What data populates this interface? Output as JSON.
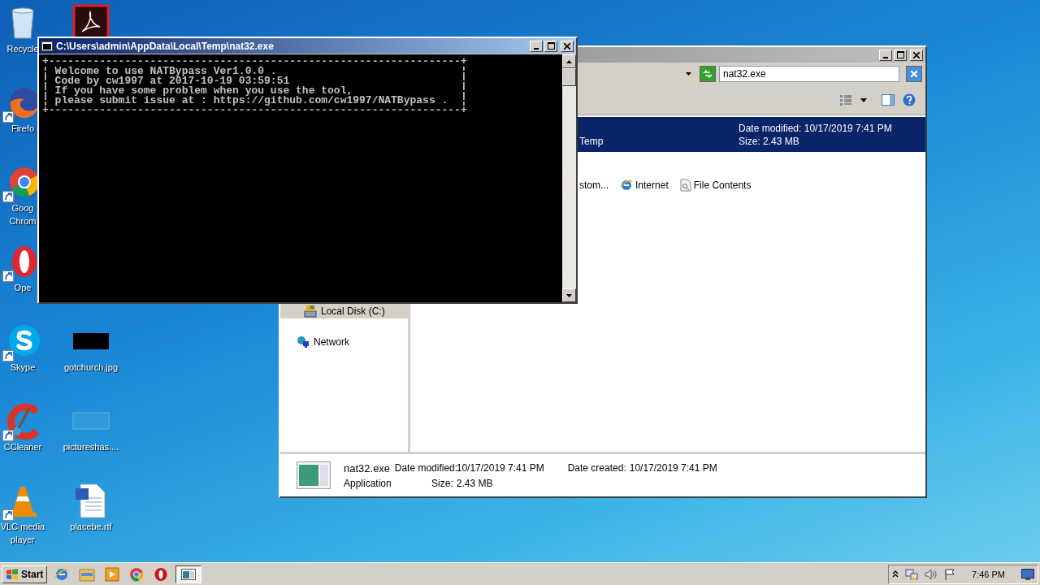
{
  "desktop": {
    "icons_column_1": [
      {
        "kind": "recycle-bin",
        "lines": [
          "Recycle"
        ],
        "shortcut": false
      },
      {
        "kind": "firefox",
        "lines": [
          "Firefo"
        ],
        "shortcut": true
      },
      {
        "kind": "chrome",
        "lines": [
          "Goog",
          "Chrom"
        ],
        "shortcut": true
      },
      {
        "kind": "opera",
        "lines": [
          "Ope"
        ],
        "shortcut": true
      },
      {
        "kind": "skype",
        "lines": [
          "Skype"
        ],
        "shortcut": true
      },
      {
        "kind": "ccleaner",
        "lines": [
          "CCleaner"
        ],
        "shortcut": true
      },
      {
        "kind": "vlc",
        "lines": [
          "VLC media",
          "player"
        ],
        "shortcut": true
      }
    ],
    "icons_column_2": [
      {
        "kind": "acrobat",
        "shortcut": false
      },
      {
        "kind": "dark-image",
        "lines": [
          "gotchurch.jpg"
        ],
        "shortcut": false
      },
      {
        "kind": "faint-image",
        "lines": [
          "pictureshas...."
        ],
        "shortcut": false
      },
      {
        "kind": "word",
        "lines": [
          "placebe.rtf"
        ],
        "shortcut": false
      }
    ]
  },
  "console": {
    "title": "C:\\Users\\admin\\AppData\\Local\\Temp\\nat32.exe",
    "lines": [
      "+-----------------------------------------------------------------+",
      "¦ Welcome to use NATBypass Ver1.0.0 .                             ¦",
      "¦ Code by cw1997 at 2017-10-19 03:59:51                           ¦",
      "¦ If you have some problem when you use the tool,                 ¦",
      "¦ please submit issue at : https://github.com/cw1997/NATBypass .  ¦",
      "+-----------------------------------------------------------------+"
    ]
  },
  "explorer": {
    "search": {
      "value": "nat32.exe"
    },
    "result": {
      "selected": true,
      "location": "Temp",
      "date_modified": "Date modified: 10/17/2019 7:41 PM",
      "size": "Size: 2.43 MB"
    },
    "search_again": [
      {
        "kind": "custom",
        "label": "stom..."
      },
      {
        "kind": "internet",
        "label": "Internet"
      },
      {
        "kind": "file-contents",
        "label": "File Contents"
      }
    ],
    "nav": [
      {
        "kind": "drive",
        "label": "Local Disk (C:)",
        "selected": true
      },
      {
        "kind": "network",
        "label": "Network",
        "selected": false
      }
    ],
    "details": {
      "name": "nat32.exe",
      "type": "Application",
      "fields": [
        {
          "label": "Date modified:",
          "value": "10/17/2019 7:41 PM"
        },
        {
          "label": "Date created:",
          "value": "10/17/2019 7:41 PM"
        },
        {
          "label": "Size:",
          "value": "2.43 MB"
        }
      ]
    }
  },
  "taskbar": {
    "start": "Start",
    "quick_launch": [
      {
        "kind": "ie"
      },
      {
        "kind": "folder"
      },
      {
        "kind": "media-player"
      },
      {
        "kind": "chrome"
      },
      {
        "kind": "opera"
      }
    ],
    "tasks": [
      {
        "kind": "console",
        "selected": true
      }
    ],
    "clock": "7:46 PM"
  }
}
